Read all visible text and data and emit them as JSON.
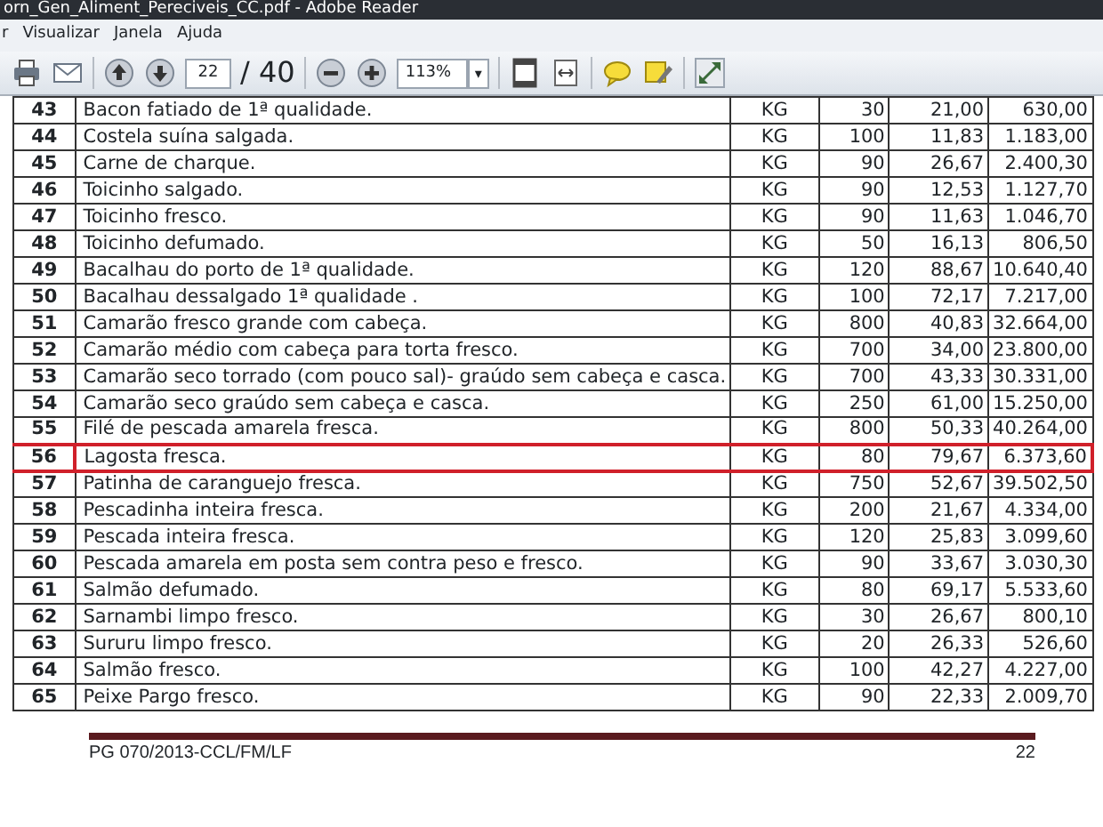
{
  "window": {
    "title": "orn_Gen_Aliment_Pereciveis_CC.pdf - Adobe Reader"
  },
  "menu": [
    "r",
    "Visualizar",
    "Janela",
    "Ajuda"
  ],
  "toolbar": {
    "page": "22",
    "page_total": "/ 40",
    "zoom": "113%",
    "dropdown": "▾"
  },
  "table": {
    "rows": [
      {
        "n": "43",
        "desc": "Bacon fatiado de 1ª qualidade.",
        "unit": "KG",
        "qty": "30",
        "price": "21,00",
        "total": "630,00",
        "highlighted": false
      },
      {
        "n": "44",
        "desc": "Costela suína salgada.",
        "unit": "KG",
        "qty": "100",
        "price": "11,83",
        "total": "1.183,00",
        "highlighted": false
      },
      {
        "n": "45",
        "desc": "Carne de charque.",
        "unit": "KG",
        "qty": "90",
        "price": "26,67",
        "total": "2.400,30",
        "highlighted": false
      },
      {
        "n": "46",
        "desc": "Toicinho salgado.",
        "unit": "KG",
        "qty": "90",
        "price": "12,53",
        "total": "1.127,70",
        "highlighted": false
      },
      {
        "n": "47",
        "desc": "Toicinho fresco.",
        "unit": "KG",
        "qty": "90",
        "price": "11,63",
        "total": "1.046,70",
        "highlighted": false
      },
      {
        "n": "48",
        "desc": "Toicinho defumado.",
        "unit": "KG",
        "qty": "50",
        "price": "16,13",
        "total": "806,50",
        "highlighted": false
      },
      {
        "n": "49",
        "desc": "Bacalhau do porto de 1ª qualidade.",
        "unit": "KG",
        "qty": "120",
        "price": "88,67",
        "total": "10.640,40",
        "highlighted": false
      },
      {
        "n": "50",
        "desc": "Bacalhau dessalgado 1ª qualidade .",
        "unit": "KG",
        "qty": "100",
        "price": "72,17",
        "total": "7.217,00",
        "highlighted": false
      },
      {
        "n": "51",
        "desc": "Camarão fresco grande com cabeça.",
        "unit": "KG",
        "qty": "800",
        "price": "40,83",
        "total": "32.664,00",
        "highlighted": false
      },
      {
        "n": "52",
        "desc": "Camarão médio com cabeça para torta fresco.",
        "unit": "KG",
        "qty": "700",
        "price": "34,00",
        "total": "23.800,00",
        "highlighted": false
      },
      {
        "n": "53",
        "desc": "Camarão seco torrado (com pouco sal)- graúdo sem cabeça e casca.",
        "unit": "KG",
        "qty": "700",
        "price": "43,33",
        "total": "30.331,00",
        "highlighted": false
      },
      {
        "n": "54",
        "desc": "Camarão seco graúdo sem cabeça e casca.",
        "unit": "KG",
        "qty": "250",
        "price": "61,00",
        "total": "15.250,00",
        "highlighted": false
      },
      {
        "n": "55",
        "desc": "Filé de pescada amarela fresca.",
        "unit": "KG",
        "qty": "800",
        "price": "50,33",
        "total": "40.264,00",
        "highlighted": false
      },
      {
        "n": "56",
        "desc": "Lagosta fresca.",
        "unit": "KG",
        "qty": "80",
        "price": "79,67",
        "total": "6.373,60",
        "highlighted": true
      },
      {
        "n": "57",
        "desc": "Patinha de caranguejo fresca.",
        "unit": "KG",
        "qty": "750",
        "price": "52,67",
        "total": "39.502,50",
        "highlighted": false
      },
      {
        "n": "58",
        "desc": "Pescadinha inteira fresca.",
        "unit": "KG",
        "qty": "200",
        "price": "21,67",
        "total": "4.334,00",
        "highlighted": false
      },
      {
        "n": "59",
        "desc": "Pescada inteira fresca.",
        "unit": "KG",
        "qty": "120",
        "price": "25,83",
        "total": "3.099,60",
        "highlighted": false
      },
      {
        "n": "60",
        "desc": "Pescada amarela em posta sem contra peso e fresco.",
        "unit": "KG",
        "qty": "90",
        "price": "33,67",
        "total": "3.030,30",
        "highlighted": false
      },
      {
        "n": "61",
        "desc": "Salmão defumado.",
        "unit": "KG",
        "qty": "80",
        "price": "69,17",
        "total": "5.533,60",
        "highlighted": false
      },
      {
        "n": "62",
        "desc": "Sarnambi limpo fresco.",
        "unit": "KG",
        "qty": "30",
        "price": "26,67",
        "total": "800,10",
        "highlighted": false
      },
      {
        "n": "63",
        "desc": "Sururu limpo fresco.",
        "unit": "KG",
        "qty": "20",
        "price": "26,33",
        "total": "526,60",
        "highlighted": false
      },
      {
        "n": "64",
        "desc": "Salmão fresco.",
        "unit": "KG",
        "qty": "100",
        "price": "42,27",
        "total": "4.227,00",
        "highlighted": false
      },
      {
        "n": "65",
        "desc": "Peixe Pargo fresco.",
        "unit": "KG",
        "qty": "90",
        "price": "22,33",
        "total": "2.009,70",
        "highlighted": false
      }
    ]
  },
  "footer": {
    "code": "PG 070/2013-CCL/FM/LF",
    "page": "22"
  }
}
